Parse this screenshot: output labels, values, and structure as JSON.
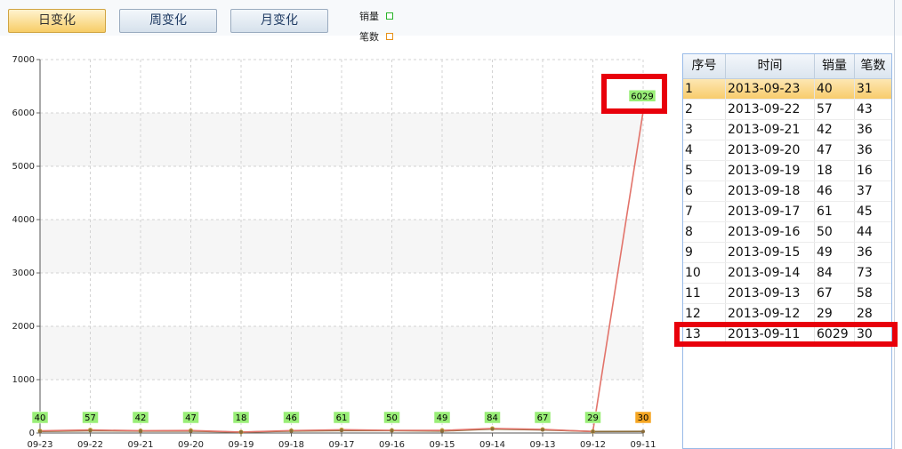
{
  "toolbar": {
    "tabs": [
      {
        "label": "日变化",
        "active": true
      },
      {
        "label": "周变化",
        "active": false
      },
      {
        "label": "月变化",
        "active": false
      }
    ]
  },
  "legend": [
    {
      "label": "销量",
      "color": "#29b329"
    },
    {
      "label": "笔数",
      "color": "#e8921a"
    }
  ],
  "chart_data": {
    "type": "line",
    "categories": [
      "09-23",
      "09-22",
      "09-21",
      "09-20",
      "09-19",
      "09-18",
      "09-17",
      "09-16",
      "09-15",
      "09-14",
      "09-13",
      "09-12",
      "09-11"
    ],
    "ylim": [
      0,
      7000
    ],
    "yticks": [
      0,
      1000,
      2000,
      3000,
      4000,
      5000,
      6000,
      7000
    ],
    "series": [
      {
        "name": "销量",
        "values": [
          40,
          57,
          42,
          47,
          18,
          46,
          61,
          50,
          49,
          84,
          67,
          29,
          6029
        ]
      },
      {
        "name": "笔数",
        "values": [
          31,
          43,
          36,
          36,
          16,
          37,
          45,
          44,
          36,
          73,
          58,
          28,
          30
        ]
      }
    ],
    "data_labels": [
      40,
      57,
      42,
      47,
      18,
      46,
      61,
      50,
      49,
      84,
      67,
      29,
      6029,
      30
    ],
    "grid": true
  },
  "table": {
    "columns": [
      "序号",
      "时间",
      "销量",
      "笔数"
    ],
    "rows": [
      [
        "1",
        "2013-09-23",
        "40",
        "31"
      ],
      [
        "2",
        "2013-09-22",
        "57",
        "43"
      ],
      [
        "3",
        "2013-09-21",
        "42",
        "36"
      ],
      [
        "4",
        "2013-09-20",
        "47",
        "36"
      ],
      [
        "5",
        "2013-09-19",
        "18",
        "16"
      ],
      [
        "6",
        "2013-09-18",
        "46",
        "37"
      ],
      [
        "7",
        "2013-09-17",
        "61",
        "45"
      ],
      [
        "8",
        "2013-09-16",
        "50",
        "44"
      ],
      [
        "9",
        "2013-09-15",
        "49",
        "36"
      ],
      [
        "10",
        "2013-09-14",
        "84",
        "73"
      ],
      [
        "11",
        "2013-09-13",
        "67",
        "58"
      ],
      [
        "12",
        "2013-09-12",
        "29",
        "28"
      ],
      [
        "13",
        "2013-09-11",
        "6029",
        "30"
      ]
    ],
    "selected_row": 0
  },
  "colors": {
    "highlight_box": "#e8000b",
    "sales_line": "#e2736a",
    "label_green": "#99ee77",
    "label_orange": "#f5a623"
  }
}
